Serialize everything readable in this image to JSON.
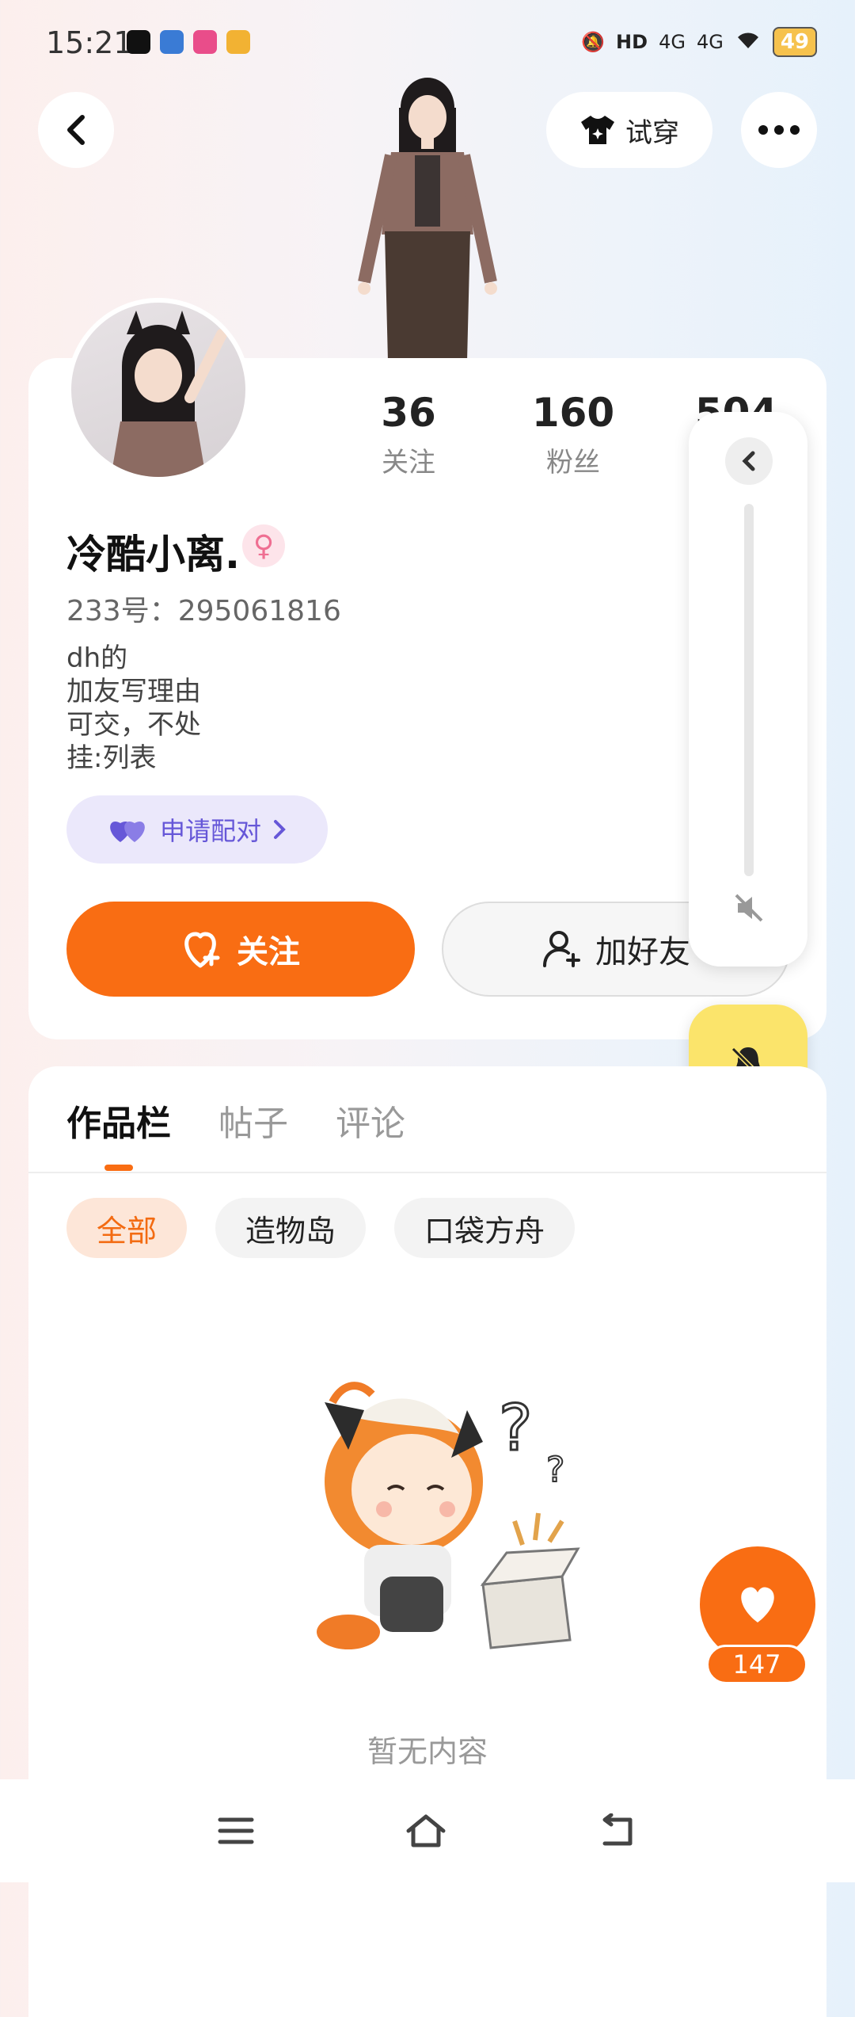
{
  "status_bar": {
    "time": "15:21",
    "hd": "HD",
    "signal1": "4G",
    "signal2": "4G",
    "battery": "49"
  },
  "header": {
    "try_on_label": "试穿"
  },
  "profile": {
    "following_count": "36",
    "following_label": "关注",
    "followers_count": "160",
    "followers_label": "粉丝",
    "third_count": "504",
    "username": "冷酷小离.",
    "gender_symbol": "♀",
    "uid_text": "233号：295061816",
    "bio_lines": [
      "dh的",
      "加友写理由",
      "可交，不处",
      "挂:列表"
    ],
    "pair_label": "申请配对",
    "follow_label": "关注",
    "add_friend_label": "加好友"
  },
  "tabs": [
    {
      "label": "作品栏"
    },
    {
      "label": "帖子"
    },
    {
      "label": "评论"
    }
  ],
  "filters": [
    {
      "label": "全部"
    },
    {
      "label": "造物岛"
    },
    {
      "label": "口袋方舟"
    }
  ],
  "empty_state": {
    "text": "暂无内容"
  },
  "like": {
    "count": "147"
  },
  "colors": {
    "accent": "#f96d13",
    "pair_bg": "#ebe8fb",
    "bell_bg": "#fbe46b"
  }
}
